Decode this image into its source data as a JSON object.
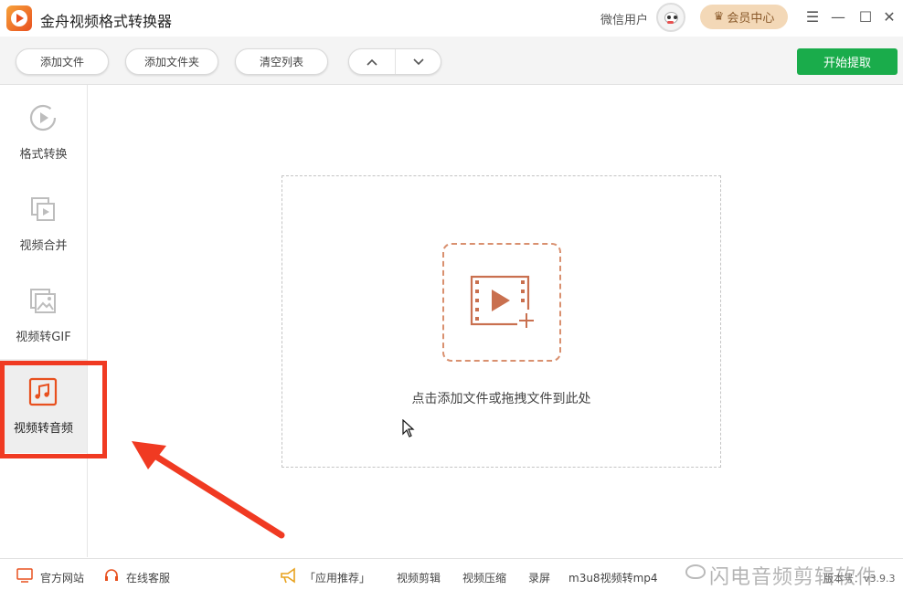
{
  "app": {
    "title": "金舟视频格式转换器"
  },
  "user": {
    "name": "微信用户"
  },
  "vip": {
    "label": "会员中心"
  },
  "window": {
    "menu_icon": "☰",
    "minimize_icon": "—",
    "maximize_icon": "☐",
    "close_icon": "✕"
  },
  "toolbar": {
    "add_file": "添加文件",
    "add_folder": "添加文件夹",
    "clear_list": "清空列表",
    "start": "开始提取"
  },
  "sidebar": {
    "items": [
      {
        "label": "格式转换",
        "icon": "play-circle-icon",
        "active": false
      },
      {
        "label": "视频合并",
        "icon": "merge-video-icon",
        "active": false
      },
      {
        "label": "视频转GIF",
        "icon": "image-gif-icon",
        "active": false
      },
      {
        "label": "视频转音频",
        "icon": "music-note-icon",
        "active": true
      }
    ]
  },
  "dropzone": {
    "text": "点击添加文件或拖拽文件到此处"
  },
  "footer": {
    "official_site": "官方网站",
    "online_service": "在线客服",
    "app_recommend": "「应用推荐」",
    "links": [
      "视频剪辑",
      "视频压缩",
      "录屏",
      "m3u8视频转mp4"
    ],
    "watermark": "闪电音频剪辑软件",
    "version": "版本号：v3.9.3"
  },
  "colors": {
    "accent_green": "#1aac4b",
    "highlight_red": "#f03a22",
    "brand_orange": "#e8501e",
    "icon_terracotta": "#c9704f"
  }
}
